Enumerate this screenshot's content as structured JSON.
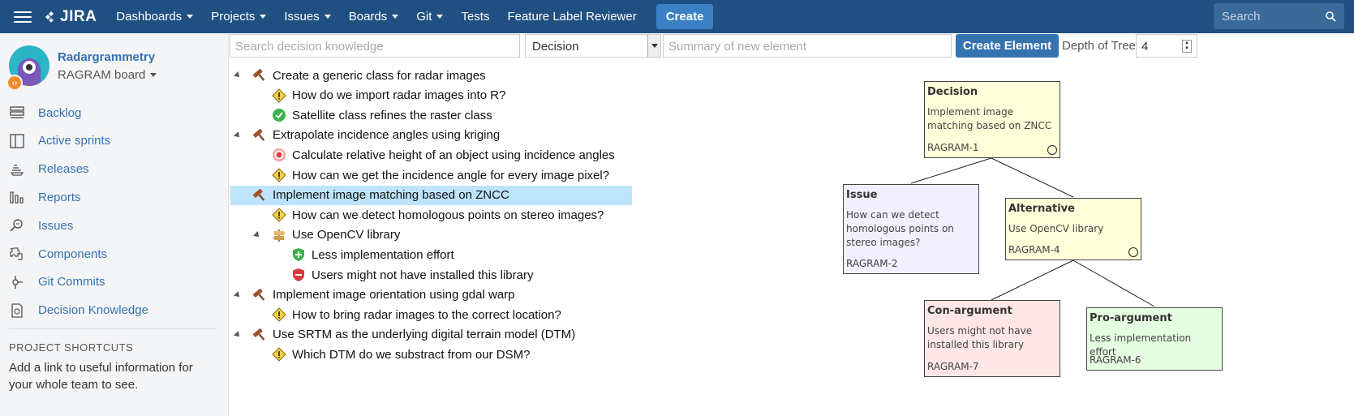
{
  "nav": {
    "logo": "JIRA",
    "items": [
      {
        "label": "Dashboards",
        "caret": true
      },
      {
        "label": "Projects",
        "caret": true
      },
      {
        "label": "Issues",
        "caret": true
      },
      {
        "label": "Boards",
        "caret": true
      },
      {
        "label": "Git",
        "caret": true
      },
      {
        "label": "Tests",
        "caret": false
      },
      {
        "label": "Feature Label Reviewer",
        "caret": false
      }
    ],
    "create_label": "Create",
    "search_placeholder": "Search",
    "colors": {
      "bar": "#205081",
      "create": "#3b7fc4"
    }
  },
  "sidebar": {
    "project_name": "Radargrammetry",
    "board_name": "RAGRAM board",
    "items": [
      {
        "label": "Backlog",
        "icon": "backlog-icon"
      },
      {
        "label": "Active sprints",
        "icon": "active-sprints-icon"
      },
      {
        "label": "Releases",
        "icon": "releases-icon"
      },
      {
        "label": "Reports",
        "icon": "reports-icon"
      },
      {
        "label": "Issues",
        "icon": "issues-icon"
      },
      {
        "label": "Components",
        "icon": "components-icon"
      },
      {
        "label": "Git Commits",
        "icon": "git-commits-icon"
      },
      {
        "label": "Decision Knowledge",
        "icon": "decision-knowledge-icon"
      }
    ],
    "shortcuts_title": "PROJECT SHORTCUTS",
    "shortcuts_text": "Add a link to useful information for your whole team to see."
  },
  "toolbar": {
    "search_placeholder": "Search decision knowledge",
    "type_selected": "Decision",
    "summary_placeholder": "Summary of new element",
    "create_label": "Create Element",
    "depth_label": "Depth of Tree",
    "depth_value": "4"
  },
  "tree": [
    {
      "text": "Create a generic class for radar images",
      "type": "decision",
      "level": 0,
      "toggle": true,
      "selected": false
    },
    {
      "text": "How do we import radar images into R?",
      "type": "issue",
      "level": 1,
      "toggle": false,
      "selected": false
    },
    {
      "text": "Satellite class refines the raster class",
      "type": "solved",
      "level": 1,
      "toggle": false,
      "selected": false
    },
    {
      "text": "Extrapolate incidence angles using kriging",
      "type": "decision",
      "level": 0,
      "toggle": true,
      "selected": false
    },
    {
      "text": "Calculate relative height of an object using incidence angles",
      "type": "goal",
      "level": 1,
      "toggle": false,
      "selected": false
    },
    {
      "text": "How can we get the incidence angle for every image pixel?",
      "type": "issue",
      "level": 1,
      "toggle": false,
      "selected": false
    },
    {
      "text": "Implement image matching based on ZNCC",
      "type": "decision",
      "level": 0,
      "toggle": true,
      "selected": true
    },
    {
      "text": "How can we detect homologous points on stereo images?",
      "type": "issue",
      "level": 1,
      "toggle": false,
      "selected": false
    },
    {
      "text": "Use OpenCV library",
      "type": "alternative",
      "level": 1,
      "toggle": true,
      "selected": false
    },
    {
      "text": "Less implementation effort",
      "type": "pro",
      "level": 2,
      "toggle": false,
      "selected": false
    },
    {
      "text": "Users might not have installed this library",
      "type": "con",
      "level": 2,
      "toggle": false,
      "selected": false
    },
    {
      "text": "Implement image orientation using gdal warp",
      "type": "decision",
      "level": 0,
      "toggle": true,
      "selected": false
    },
    {
      "text": "How to bring radar images to the correct location?",
      "type": "issue",
      "level": 1,
      "toggle": false,
      "selected": false
    },
    {
      "text": "Use SRTM as the underlying digital terrain model (DTM)",
      "type": "decision",
      "level": 0,
      "toggle": true,
      "selected": false
    },
    {
      "text": "Which DTM do we substract from our DSM?",
      "type": "issue",
      "level": 1,
      "toggle": false,
      "selected": false
    }
  ],
  "graph": {
    "nodes": [
      {
        "id": "decision",
        "title": "Decision",
        "text": "Implement image matching based on ZNCC",
        "key": "RAGRAM-1",
        "color": "#ffffd9",
        "circle": true
      },
      {
        "id": "issue",
        "title": "Issue",
        "text": "How can we detect homologous points on stereo images?",
        "key": "RAGRAM-2",
        "color": "#f2f0ff",
        "circle": false
      },
      {
        "id": "alternative",
        "title": "Alternative",
        "text": "Use OpenCV library",
        "key": "RAGRAM-4",
        "color": "#ffffd9",
        "circle": true
      },
      {
        "id": "con",
        "title": "Con-argument",
        "text": "Users might not have installed this library",
        "key": "RAGRAM-7",
        "color": "#ffe6e6",
        "circle": false
      },
      {
        "id": "pro",
        "title": "Pro-argument",
        "text": "Less implementation effort",
        "key": "RAGRAM-6",
        "color": "#e5fde0",
        "circle": false
      }
    ]
  }
}
